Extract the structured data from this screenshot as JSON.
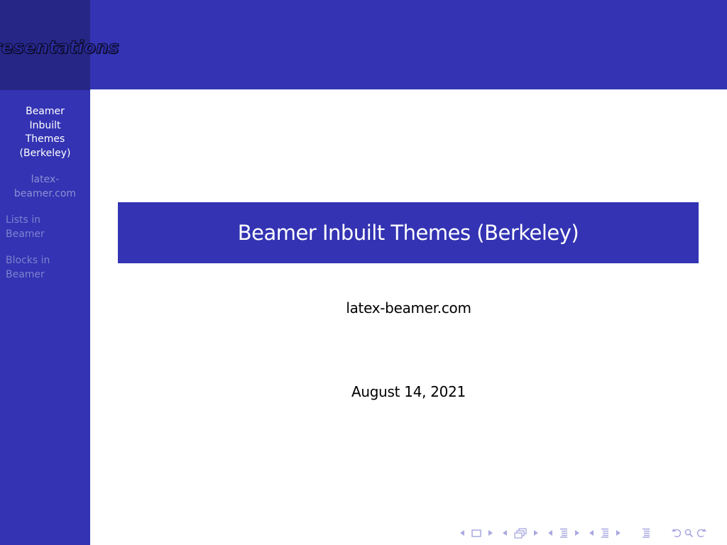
{
  "header": {
    "logo_text": "Presentations"
  },
  "sidebar": {
    "items": [
      {
        "label": "Beamer Inbuilt Themes (Berkeley)",
        "lines": [
          "Beamer",
          "Inbuilt",
          "Themes",
          "(Berkeley)"
        ],
        "state": "current"
      },
      {
        "label": "latex-beamer.com",
        "lines": [
          "latex-",
          "beamer.com"
        ],
        "state": "subtitle"
      },
      {
        "label": "Lists in Beamer",
        "lines": [
          "Lists in",
          "Beamer"
        ],
        "state": "other"
      },
      {
        "label": "Blocks in Beamer",
        "lines": [
          "Blocks in",
          "Beamer"
        ],
        "state": "other"
      }
    ]
  },
  "title_page": {
    "title": "Beamer Inbuilt Themes (Berkeley)",
    "author": "latex-beamer.com",
    "date": "August 14, 2021"
  },
  "navigation_symbols": [
    {
      "name": "previous-slide-arrow",
      "icon": "arrow-left-icon"
    },
    {
      "name": "slide-icon",
      "icon": "slide-frame-icon"
    },
    {
      "name": "next-slide-arrow",
      "icon": "arrow-right-icon"
    },
    {
      "name": "previous-frame-arrow",
      "icon": "arrow-left-icon"
    },
    {
      "name": "frame-icon",
      "icon": "stacked-frames-icon"
    },
    {
      "name": "next-frame-arrow",
      "icon": "arrow-right-icon"
    },
    {
      "name": "previous-subsection-arrow",
      "icon": "arrow-left-icon"
    },
    {
      "name": "subsection-icon",
      "icon": "subsection-lines-icon"
    },
    {
      "name": "next-subsection-arrow",
      "icon": "arrow-right-icon"
    },
    {
      "name": "previous-section-arrow",
      "icon": "arrow-left-icon"
    },
    {
      "name": "section-icon",
      "icon": "section-lines-icon"
    },
    {
      "name": "next-section-arrow",
      "icon": "arrow-right-icon"
    },
    {
      "name": "document-icon",
      "icon": "document-lines-icon"
    },
    {
      "name": "back-icon",
      "icon": "undo-icon"
    },
    {
      "name": "search-icon",
      "icon": "magnifier-icon"
    },
    {
      "name": "forward-icon",
      "icon": "redo-icon"
    }
  ],
  "colors": {
    "primary": "#3333b3",
    "sidebar_corner": "#262686",
    "sidebar_current_text": "#ffffff",
    "sidebar_other_text": "#8080cf",
    "nav_symbols": "#a8a8e0",
    "body_text": "#000000",
    "background": "#ffffff"
  }
}
